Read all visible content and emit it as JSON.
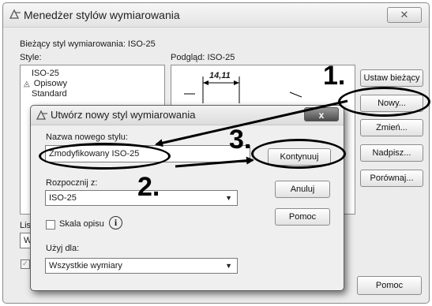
{
  "main_dialog": {
    "title": "Menedżer stylów wymiarowania",
    "close": "✕",
    "current_style_label": "Bieżący styl wymiarowania: ISO-25",
    "styles_label": "Style:",
    "styles": [
      "ISO-25",
      "Opisowy",
      "Standard"
    ],
    "preview_label": "Podgląd: ISO-25",
    "preview_dimension": "14,11",
    "list_label_partial": "Lista",
    "list_combo_partial": "Wsz",
    "check_partial": "N\nd",
    "buttons": {
      "set_current": "Ustaw bieżący",
      "new": "Nowy...",
      "modify": "Zmień...",
      "override": "Nadpisz...",
      "compare": "Porównaj...",
      "help": "Pomoc"
    }
  },
  "new_style_dialog": {
    "title": "Utwórz nowy styl wymiarowania",
    "close": "x",
    "new_name_label": "Nazwa nowego stylu:",
    "new_name_value": "Zmodyfikowany ISO-25",
    "start_with_label": "Rozpocznij z:",
    "start_with_value": "ISO-25",
    "annotative_label": "Skala opisu",
    "info_glyph": "i",
    "use_for_label": "Użyj dla:",
    "use_for_value": "Wszystkie wymiary",
    "buttons": {
      "continue": "Kontynuuj",
      "cancel": "Anuluj",
      "help": "Pomoc"
    }
  },
  "annotations": {
    "step1": "1.",
    "step2": "2.",
    "step3": "3."
  },
  "icons": {
    "app": "dimension-style-icon",
    "annotative": "annotative-triangle-icon"
  }
}
